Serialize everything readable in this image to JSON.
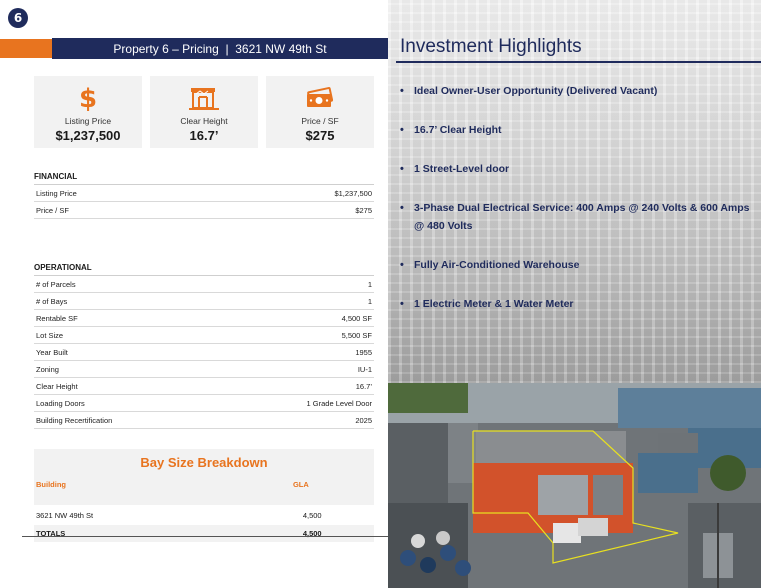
{
  "page_number": "6",
  "header": {
    "title": "Property 6 – Pricing  |  3621 NW 49th St"
  },
  "kpis": [
    {
      "icon": "dollar-icon",
      "label": "Listing Price",
      "value": "$1,237,500"
    },
    {
      "icon": "warehouse-icon",
      "label": "Clear Height",
      "value": "16.7’"
    },
    {
      "icon": "cash-icon",
      "label": "Price / SF",
      "value": "$275"
    }
  ],
  "financial": {
    "title": "FINANCIAL",
    "rows": [
      {
        "label": "Listing Price",
        "value": "$1,237,500"
      },
      {
        "label": "Price / SF",
        "value": "$275"
      }
    ]
  },
  "operational": {
    "title": "OPERATIONAL",
    "rows": [
      {
        "label": "# of Parcels",
        "value": "1"
      },
      {
        "label": "# of Bays",
        "value": "1"
      },
      {
        "label": "Rentable SF",
        "value": "4,500 SF"
      },
      {
        "label": "Lot Size",
        "value": "5,500 SF"
      },
      {
        "label": "Year Built",
        "value": "1955"
      },
      {
        "label": "Zoning",
        "value": "IU-1"
      },
      {
        "label": "Clear Height",
        "value": "16.7’"
      },
      {
        "label": "Loading Doors",
        "value": "1 Grade Level Door"
      },
      {
        "label": "Building Recertification",
        "value": "2025"
      }
    ]
  },
  "bay_breakdown": {
    "title": "Bay Size Breakdown",
    "col_building": "Building",
    "col_gla": "GLA",
    "rows": [
      {
        "building": "3621 NW 49th St",
        "gla": "4,500"
      }
    ],
    "total_label": "TOTALS",
    "total_gla": "4,500"
  },
  "highlights": {
    "title": "Investment Highlights",
    "items": [
      "Ideal Owner-User Opportunity (Delivered Vacant)",
      "16.7’ Clear Height",
      "1 Street-Level door",
      "3-Phase Dual Electrical Service: 400 Amps @ 240 Volts & 600 Amps @ 480 Volts",
      "Fully Air-Conditioned Warehouse",
      "1 Electric Meter & 1 Water Meter"
    ]
  },
  "colors": {
    "navy": "#1f2b5c",
    "orange": "#e8741f",
    "card_gray": "#f2f2f2"
  }
}
